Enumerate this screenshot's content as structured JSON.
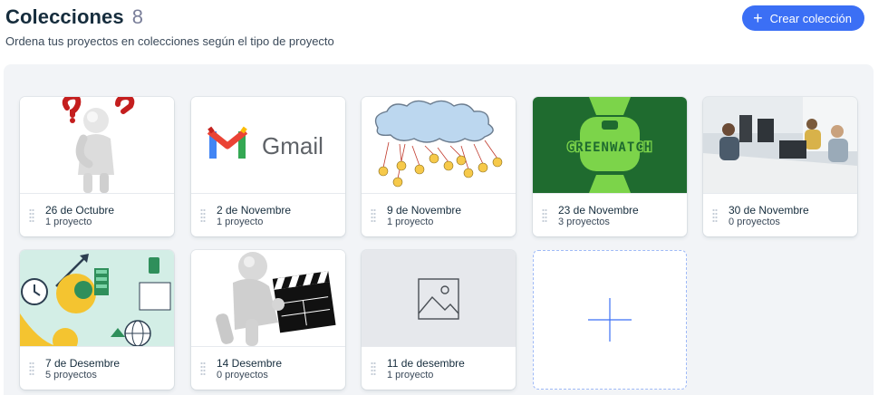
{
  "header": {
    "title": "Colecciones",
    "count": "8",
    "subtitle": "Ordena tus proyectos en colecciones según el tipo de proyecto",
    "create_button": "Crear colección"
  },
  "collections": [
    {
      "name": "26 de Octubre",
      "projects": "1 proyecto",
      "thumbnail": "figure-thinking-question-marks"
    },
    {
      "name": "2 de Novembre",
      "projects": "1 proyecto",
      "thumbnail": "gmail-logo",
      "thumbnail_text": "Gmail"
    },
    {
      "name": "9 de Novembre",
      "projects": "1 proyecto",
      "thumbnail": "cloud-lightbulbs"
    },
    {
      "name": "23 de Novembre",
      "projects": "3 proyectos",
      "thumbnail": "greenwatch-logo",
      "thumbnail_text": "GREENWATCH"
    },
    {
      "name": "30 de Novembre",
      "projects": "0 proyectos",
      "thumbnail": "office-photo"
    },
    {
      "name": "7 de Desembre",
      "projects": "5 proyectos",
      "thumbnail": "finance-illustration"
    },
    {
      "name": "14 Desembre",
      "projects": "0 proyectos",
      "thumbnail": "figure-clapperboard"
    },
    {
      "name": "11 de desembre",
      "projects": "1 proyecto",
      "thumbnail": "image-placeholder-icon"
    }
  ],
  "colors": {
    "accent": "#3b6ff5",
    "title": "#162d3d",
    "count": "#7a7f9a",
    "panel_bg": "#f2f4f7",
    "greenwatch_bg": "#1f6b2f",
    "greenwatch_green": "#7cd44a"
  }
}
